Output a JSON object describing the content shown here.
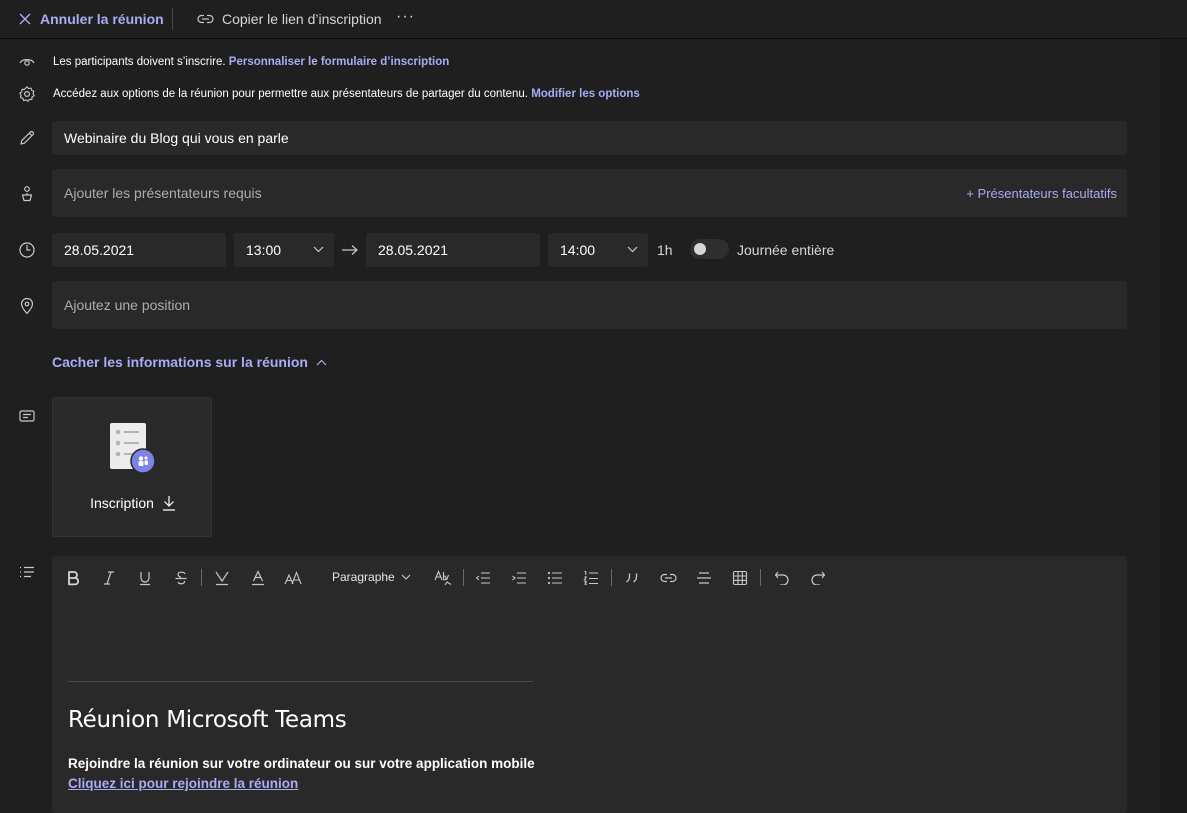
{
  "toolbar": {
    "cancel_label": "Annuler la réunion",
    "copy_label": "Copier le lien d’inscription",
    "more_label": "···"
  },
  "info": {
    "registration_text": "Les participants doivent s’inscrire.",
    "registration_link": "Personnaliser le formulaire d’inscription",
    "options_text": "Accédez aux options de la réunion pour permettre aux présentateurs de partager du contenu.",
    "options_link": "Modifier les options"
  },
  "form": {
    "title_value": "Webinaire du Blog qui vous en parle",
    "presenters_placeholder": "Ajouter les présentateurs requis",
    "optional_presenters": "+ Présentateurs facultatifs",
    "start_date": "28.05.2021",
    "start_time": "13:00",
    "end_date": "28.05.2021",
    "end_time": "14:00",
    "duration": "1h",
    "all_day_label": "Journée entière",
    "all_day_on": false,
    "location_placeholder": "Ajoutez une position"
  },
  "details": {
    "hide_label": "Cacher les informations sur la réunion",
    "registration_card_label": "Inscription"
  },
  "editor": {
    "paragraph_style": "Paragraphe",
    "heading": "Réunion Microsoft Teams",
    "join_text": "Rejoindre la réunion sur votre ordinateur ou sur votre application mobile",
    "join_link": "Cliquez ici pour rejoindre la réunion"
  },
  "colors": {
    "accent": "#aaabf5",
    "background": "#1f1f1f",
    "field": "#292929"
  }
}
